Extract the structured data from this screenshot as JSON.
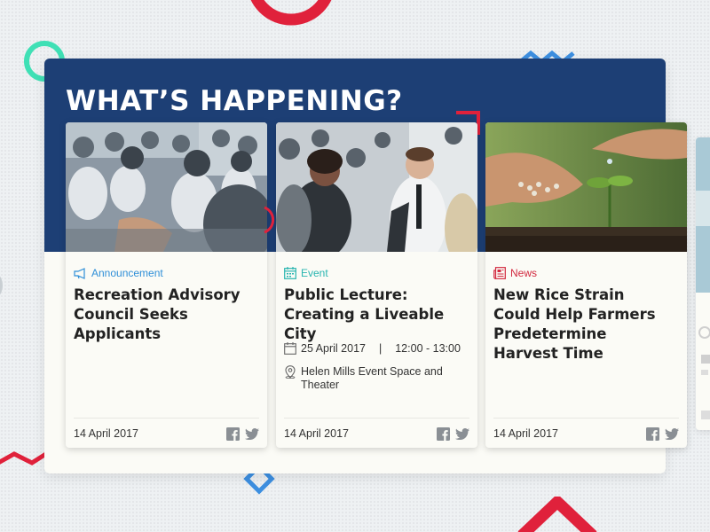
{
  "section": {
    "heading": "WHAT’S HAPPENING?"
  },
  "cards": [
    {
      "category": "Announcement",
      "category_color": "#2f8fd8",
      "category_icon": "megaphone-icon",
      "title": "Recreation Advisory Council Seeks Applicants",
      "date": "14 April 2017"
    },
    {
      "category": "Event",
      "category_color": "#29b5b0",
      "category_icon": "calendar-icon",
      "title": "Public Lecture: Creating a Liveable City",
      "event_date": "25 April 2017",
      "separator": "|",
      "event_time": "12:00 - 13:00",
      "location": "Helen Mills Event Space and Theater",
      "date": "14 April 2017"
    },
    {
      "category": "News",
      "category_color": "#d2293f",
      "category_icon": "newspaper-icon",
      "title": "New Rice Strain Could Help Farmers Predetermine Harvest Time",
      "date": "14 April 2017"
    }
  ],
  "share_icons": [
    "facebook-icon",
    "twitter-icon"
  ],
  "colors": {
    "band": "#1d3f75",
    "red_accent": "#e0213b",
    "blue_accent": "#3d8fe0",
    "teal_accent": "#3fe0b5"
  }
}
